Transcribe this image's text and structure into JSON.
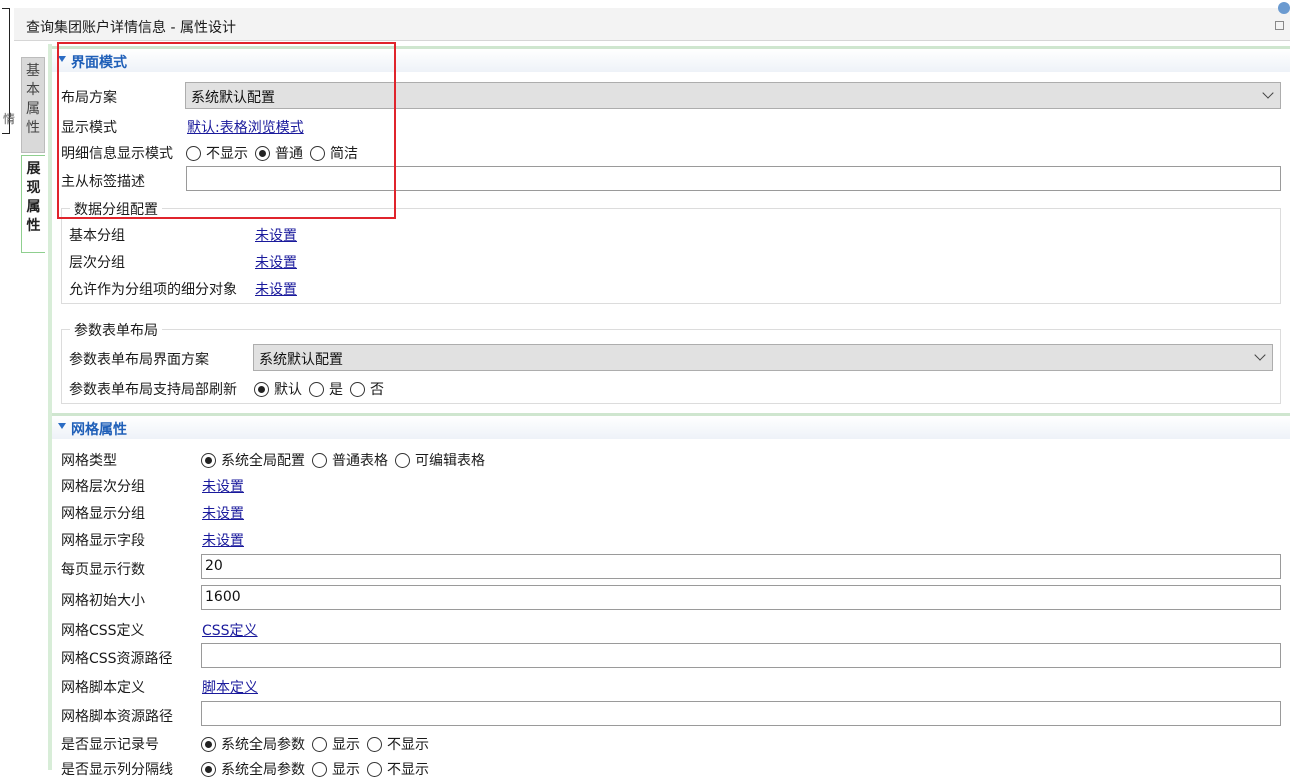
{
  "window": {
    "title": "查询集团账户详情信息 - 属性设计",
    "left_char": "情"
  },
  "vtabs": {
    "basic": [
      "基",
      "本",
      "属",
      "性"
    ],
    "display": [
      "展",
      "现",
      "属",
      "性"
    ]
  },
  "ui_mode": {
    "header": "界面模式",
    "layout_label": "布局方案",
    "layout_value": "系统默认配置",
    "display_mode_label": "显示模式",
    "display_mode_value": "默认:表格浏览模式",
    "detail_mode_label": "明细信息显示模式",
    "detail_mode_options": [
      {
        "label": "不显示",
        "checked": false
      },
      {
        "label": "普通",
        "checked": true
      },
      {
        "label": "简洁",
        "checked": false
      }
    ],
    "master_detail_label": "主从标签描述",
    "master_detail_value": ""
  },
  "data_grouping": {
    "title": "数据分组配置",
    "basic_label": "基本分组",
    "basic_value": "未设置",
    "level_label": "层次分组",
    "level_value": "未设置",
    "sub_label": "允许作为分组项的细分对象",
    "sub_value": "未设置"
  },
  "param_layout": {
    "title": "参数表单布局",
    "scheme_label": "参数表单布局界面方案",
    "scheme_value": "系统默认配置",
    "refresh_label": "参数表单布局支持局部刷新",
    "refresh_options": [
      {
        "label": "默认",
        "checked": true
      },
      {
        "label": "是",
        "checked": false
      },
      {
        "label": "否",
        "checked": false
      }
    ]
  },
  "grid": {
    "header": "网格属性",
    "type_label": "网格类型",
    "type_options": [
      {
        "label": "系统全局配置",
        "checked": true
      },
      {
        "label": "普通表格",
        "checked": false
      },
      {
        "label": "可编辑表格",
        "checked": false
      }
    ],
    "level_group_label": "网格层次分组",
    "level_group_value": "未设置",
    "display_group_label": "网格显示分组",
    "display_group_value": "未设置",
    "display_field_label": "网格显示字段",
    "display_field_value": "未设置",
    "rows_per_page_label": "每页显示行数",
    "rows_per_page_value": "20",
    "init_size_label": "网格初始大小",
    "init_size_value": "1600",
    "css_label": "网格CSS定义",
    "css_value": "CSS定义",
    "css_path_label": "网格CSS资源路径",
    "css_path_value": "",
    "script_label": "网格脚本定义",
    "script_value": "脚本定义",
    "script_path_label": "网格脚本资源路径",
    "script_path_value": "",
    "show_record_no_label": "是否显示记录号",
    "show_record_no_options": [
      {
        "label": "系统全局参数",
        "checked": true
      },
      {
        "label": "显示",
        "checked": false
      },
      {
        "label": "不显示",
        "checked": false
      }
    ],
    "show_col_sep_label": "是否显示列分隔线",
    "show_col_sep_options": [
      {
        "label": "系统全局参数",
        "checked": true
      },
      {
        "label": "显示",
        "checked": false
      },
      {
        "label": "不显示",
        "checked": false
      }
    ]
  }
}
